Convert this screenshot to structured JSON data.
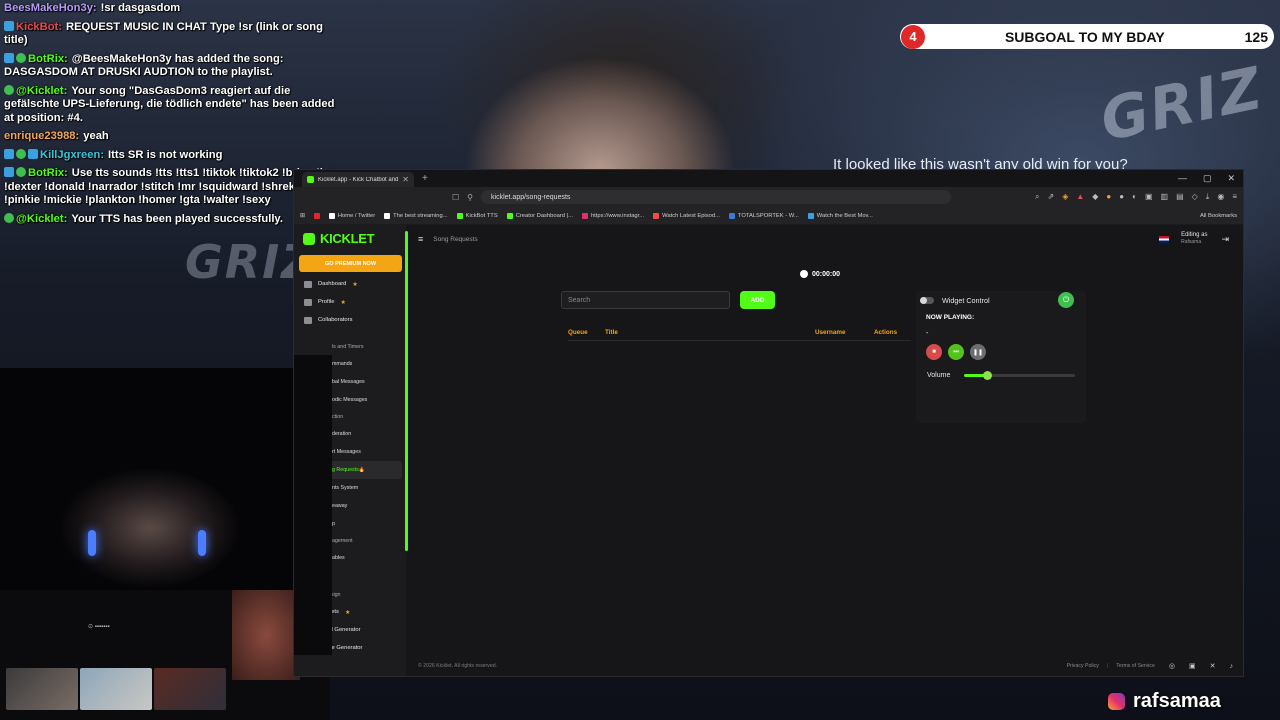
{
  "stream": {
    "background_brand_text": "GRIZ",
    "caption": "It looked like this wasn't any old win for you?",
    "social_handle": "rafsamaa"
  },
  "subgoal": {
    "number": "4",
    "label": "SUBGOAL TO MY BDAY",
    "count": "125"
  },
  "chat": [
    {
      "user": "BeesMakeHon3y:",
      "user_color": "#b59cf6",
      "badges": [],
      "text": "!sr dasgasdom"
    },
    {
      "user": "KickBot:",
      "user_color": "#e84a4a",
      "badges": [
        "blue"
      ],
      "text": "REQUEST MUSIC IN CHAT Type !sr (link or song title)"
    },
    {
      "user": "BotRix:",
      "user_color": "#53fc18",
      "badges": [
        "blue",
        "green"
      ],
      "text": "@BeesMakeHon3y has added the song: DASGASDOM AT DRUSKI AUDTION to the playlist."
    },
    {
      "user": "@Kicklet:",
      "user_color": "#53fc18",
      "badges": [
        "green"
      ],
      "text": "Your song \"DasGasDom3 reagiert auf die gefälschte UPS-Lieferung, die tödlich endete\" has been added at position: #4."
    },
    {
      "user": "enrique23988:",
      "user_color": "#f2a65a",
      "badges": [],
      "text": "yeah"
    },
    {
      "user": "KillJgxreen:",
      "user_color": "#39c7d9",
      "badges": [
        "blue",
        "green",
        "blue"
      ],
      "text": "Itts SR is not working"
    },
    {
      "user": "BotRix:",
      "user_color": "#53fc18",
      "badges": [
        "blue",
        "green"
      ],
      "text": "Use tts sounds !tts !tts1 !tiktok !tiktok2 !brian !ivy !dexter !donald !narrador !stitch !mr !squidward !shrek !peter !pinkie !mickie !plankton !homer !gta !walter !sexy"
    },
    {
      "user": "@Kicklet:",
      "user_color": "#53fc18",
      "badges": [
        "green"
      ],
      "text": "Your TTS has been played successfully."
    }
  ],
  "browser": {
    "tab_title": "Kicklet.app - Kick Chatbot and C",
    "url": "kicklet.app/song-requests",
    "bookmarks": [
      {
        "label": "Home / Twitter",
        "color": "#ffffff"
      },
      {
        "label": "The best streaming...",
        "color": "#ffffff"
      },
      {
        "label": "KickBot TTS",
        "color": "#53fc18"
      },
      {
        "label": "Creator Dashboard |...",
        "color": "#53fc18"
      },
      {
        "label": "https://www.instagr...",
        "color": "#e1306c"
      },
      {
        "label": "Watch Latest Episod...",
        "color": "#f04a4a"
      },
      {
        "label": "TOTALSPORTEK - W...",
        "color": "#3a7bd5"
      },
      {
        "label": "Watch the Best Mov...",
        "color": "#3aa0e0"
      }
    ],
    "all_bookmarks": "All Bookmarks"
  },
  "app": {
    "brand": "KICKLET",
    "premium": "GO PREMIUM NOW",
    "breadcrumb": "Song Requests",
    "editing_as": "Editing as",
    "editing_user": "Rafsama",
    "nav_top": [
      {
        "label": "Dashboard",
        "star": true
      },
      {
        "label": "Profile",
        "star": true
      },
      {
        "label": "Collaborators",
        "star": false
      }
    ],
    "nav_groups": [
      {
        "type": "head",
        "label": "ls and Timers"
      },
      {
        "type": "sub",
        "label": "mmands"
      },
      {
        "type": "sub",
        "label": "bal Messages"
      },
      {
        "type": "sub",
        "label": "odic Messages"
      },
      {
        "type": "head",
        "label": "ction"
      },
      {
        "type": "sub",
        "label": "deration"
      },
      {
        "type": "sub",
        "label": "rt Messages"
      },
      {
        "type": "active",
        "label": "g Requests"
      },
      {
        "type": "sub",
        "label": "nts System"
      },
      {
        "type": "sub",
        "label": "eaway"
      },
      {
        "type": "sub",
        "label": "p"
      },
      {
        "type": "head",
        "label": "agement"
      },
      {
        "type": "sub",
        "label": "ables"
      }
    ],
    "nav_bottom": [
      {
        "type": "item",
        "label": "Stats",
        "star": false
      },
      {
        "type": "section",
        "label": "Graphic Design"
      },
      {
        "type": "item",
        "label": "Widgets",
        "star": true
      },
      {
        "type": "item",
        "label": "Panel Generator",
        "star": false
      },
      {
        "type": "item",
        "label": "Emote Generator",
        "star": false
      }
    ],
    "timer": "00:00:00",
    "search_placeholder": "Search",
    "add_label": "ADD",
    "columns": {
      "queue": "Queue",
      "title": "Title",
      "username": "Username",
      "actions": "Actions"
    },
    "widget": {
      "title": "Widget Control",
      "now_playing_label": "NOW PLAYING:",
      "now_playing_song": "-",
      "volume_label": "Volume",
      "volume_level": 0.2
    },
    "footer": {
      "copyright": "© 2026 Kicklet. All rights reserved.",
      "privacy": "Privacy Policy",
      "terms": "Terms of Service"
    }
  }
}
